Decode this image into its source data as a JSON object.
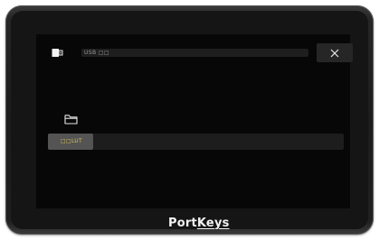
{
  "device": {
    "brand_prefix": "Port",
    "brand_suffix": "Keys"
  },
  "topbar": {
    "source_icon": "usb-drive-icon",
    "path": "USB □□",
    "close_icon": "close-icon"
  },
  "browser": {
    "folder_icon": "folder-icon",
    "items": [
      {
        "label": "□□LUT",
        "selected": true
      }
    ]
  },
  "colors": {
    "screen_bg": "#070707",
    "selected_item_bg": "#545454",
    "selected_item_text": "#d9c45b",
    "row_bg": "#1d1d1d"
  }
}
